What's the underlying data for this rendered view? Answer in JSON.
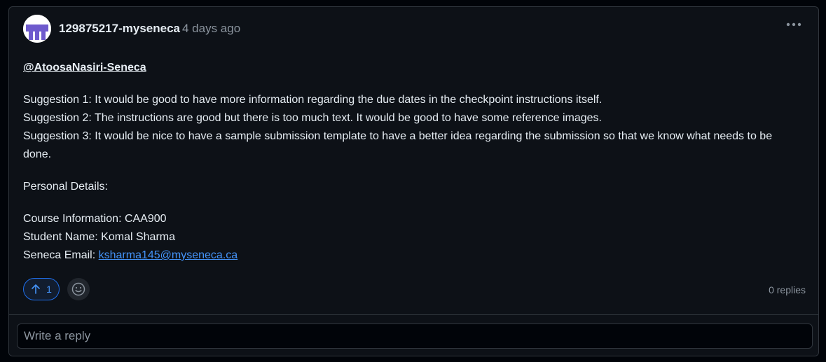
{
  "comment": {
    "author": "129875217-myseneca",
    "timestamp": "4 days ago",
    "mention": "@AtoosaNasiri-Seneca",
    "suggestions": [
      "Suggestion 1: It would be good to have more information regarding the due dates in the checkpoint instructions itself.",
      "Suggestion 2: The instructions are good but there is too much text. It would be good to have some reference images.",
      "Suggestion 3: It would be nice to have a sample submission template to have a better idea regarding the submission so that we know what needs to be done."
    ],
    "personal_details_heading": "Personal Details:",
    "details": {
      "course": "Course Information: CAA900",
      "student": "Student Name: Komal Sharma",
      "email_label": "Seneca Email: ",
      "email": "ksharma145@myseneca.ca"
    },
    "upvote_count": "1",
    "replies": "0 replies"
  },
  "reply": {
    "placeholder": "Write a reply"
  },
  "colors": {
    "background": "#0d1117",
    "text": "#e6edf3",
    "muted": "#8b949e",
    "accent": "#4493f8",
    "avatar": "#6e5acd"
  },
  "icons": {
    "avatar": "identicon-avatar",
    "more": "kebab-horizontal-icon",
    "upvote": "arrow-up-icon",
    "react": "smiley-icon"
  }
}
